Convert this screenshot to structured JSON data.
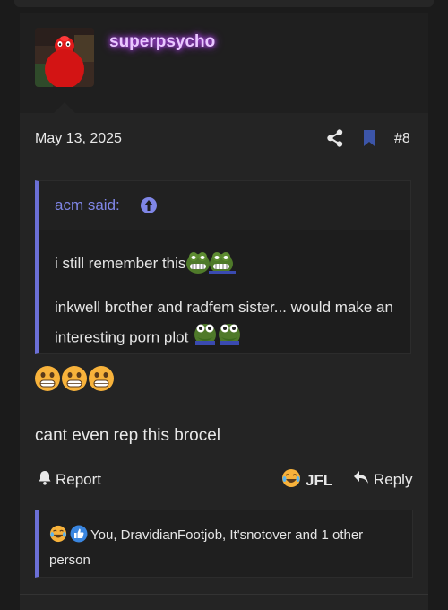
{
  "post": {
    "username": "superpsycho",
    "date": "May 13, 2025",
    "number": "#8",
    "quote": {
      "author": "acm said:",
      "line1": "i still remember this",
      "line2": "inkwell brother and radfem sister... would make an interesting porn plot"
    },
    "body": "cant even rep this brocel",
    "actions": {
      "report": "Report",
      "react": "JFL",
      "reply": "Reply"
    },
    "reactions_text": "You, DravidianFootjob, It'snotover and 1 other person"
  },
  "colors": {
    "accent": "#6b6fd6",
    "username_glow": "#c050ff",
    "bookmark": "#3c55a8"
  },
  "icons": [
    "share-icon",
    "bookmark-icon",
    "quote-up-arrow-icon",
    "bell-icon",
    "laugh-cry-icon",
    "reply-arrow-icon",
    "thumbs-up-icon",
    "grimace-emoji",
    "frog-emoji"
  ]
}
